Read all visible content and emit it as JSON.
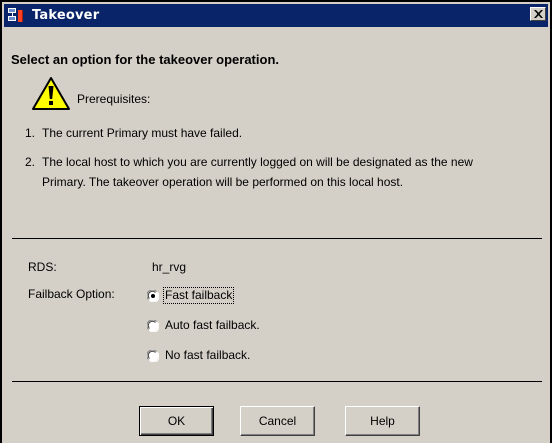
{
  "window": {
    "title": "Takeover",
    "title_icon": "application-icon",
    "close_icon": "close-icon",
    "titlebar_color": "#0a246a",
    "background_color": "#d4d0c8"
  },
  "dialog": {
    "heading": "Select an option for the takeover operation.",
    "warning_icon": "warning-icon",
    "prerequisites_label": "Prerequisites:",
    "prerequisites": [
      {
        "number": "1.",
        "text": "The current Primary must have failed."
      },
      {
        "number": "2.",
        "text": "The local host to which you are currently logged on will be designated as the new Primary. The takeover operation will be performed on this local host."
      }
    ],
    "rds_label": "RDS:",
    "rds_value": "hr_rvg",
    "failback_label": "Failback Option:",
    "failback_options": [
      {
        "label": "Fast failback",
        "selected": true
      },
      {
        "label": "Auto fast failback.",
        "selected": false
      },
      {
        "label": "No fast failback.",
        "selected": false
      }
    ]
  },
  "buttons": {
    "ok": "OK",
    "cancel": "Cancel",
    "help": "Help"
  }
}
